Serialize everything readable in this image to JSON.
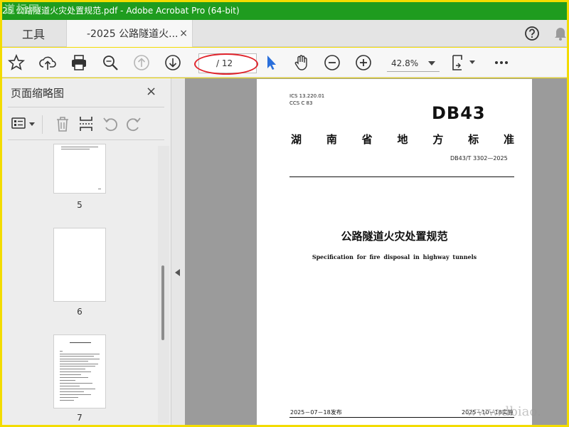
{
  "window": {
    "title": "25 公路隧道火灾处置规范.pdf - Adobe Acrobat Pro (64-bit)"
  },
  "tabs": {
    "tools_label": "工具",
    "doc_label": "-2025 公路隧道火...",
    "close_glyph": "×"
  },
  "toolbar": {
    "current_page": "",
    "page_total": "/ 12",
    "zoom": "42.8%"
  },
  "sidebar": {
    "title": "页面缩略图",
    "close_glyph": "×",
    "thumbnails": [
      {
        "label": "5"
      },
      {
        "label": "6"
      },
      {
        "label": "7"
      }
    ]
  },
  "document": {
    "ics": "ICS 13.220.01",
    "ccs": "CCS C 83",
    "db_mark": "DB43",
    "region_chars": [
      "湖",
      "南",
      "省",
      "地",
      "方",
      "标",
      "准"
    ],
    "code": "DB43/T 3302—2025",
    "cn_title": "公路隧道火灾处置规范",
    "en_title": "Specification for fire disposal in highway tunnels",
    "publish_date": "2025－07－18发布",
    "implement_date": "2025－10－18实施"
  },
  "watermarks": {
    "top_left": "道标网",
    "bottom_right": "www.dbiao."
  },
  "colors": {
    "titlebar": "#1f9c1f",
    "frame": "#f3dc00",
    "annotation_oval": "#e0232b",
    "select_tool": "#2a6fdb"
  }
}
